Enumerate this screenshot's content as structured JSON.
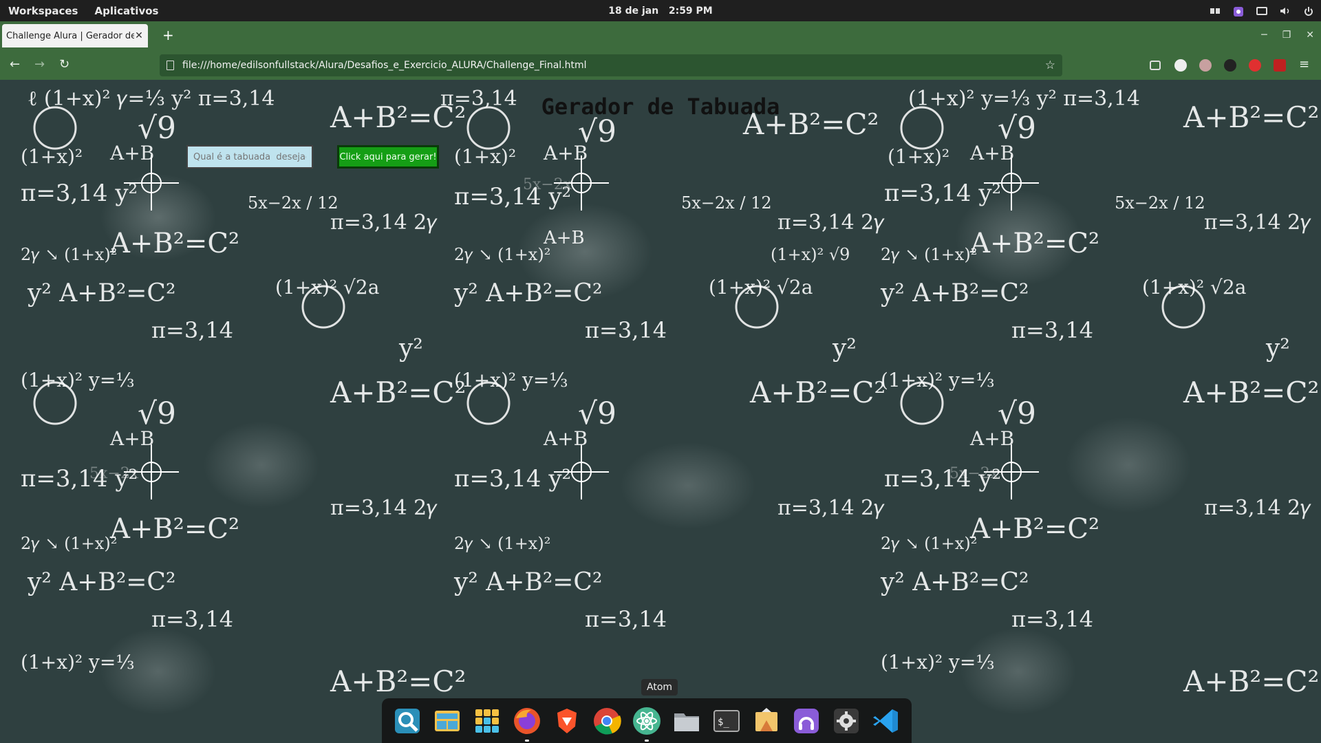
{
  "topbar": {
    "workspaces": "Workspaces",
    "apps": "Aplicativos",
    "clock_date": "18 de jan",
    "clock_time": "2:59 PM"
  },
  "browser": {
    "tab_title": "Challenge Alura | Gerador de Tabuada",
    "new_tab": "+",
    "url": "file:///home/edilsonfullstack/Alura/Desafios_e_Exercicio_ALURA/Challenge_Final.html"
  },
  "page": {
    "title": "Gerador de Tabuada",
    "input_placeholder": "Qual é a tabuada  desejada",
    "generate_label": "Click aqui para gerar!"
  },
  "dock": {
    "tooltip": "Atom",
    "apps": [
      "search-app",
      "file-manager-app",
      "app-grid",
      "firefox-app",
      "brave-app",
      "chrome-app",
      "atom-app",
      "files-app",
      "terminal-app",
      "installer-app",
      "podcast-app",
      "settings-app",
      "vscode-app"
    ]
  },
  "colors": {
    "browser_green": "#3d6b3d",
    "button_green": "#159e15",
    "input_bg": "#bfe3ee",
    "board_bg": "#2f4040"
  }
}
